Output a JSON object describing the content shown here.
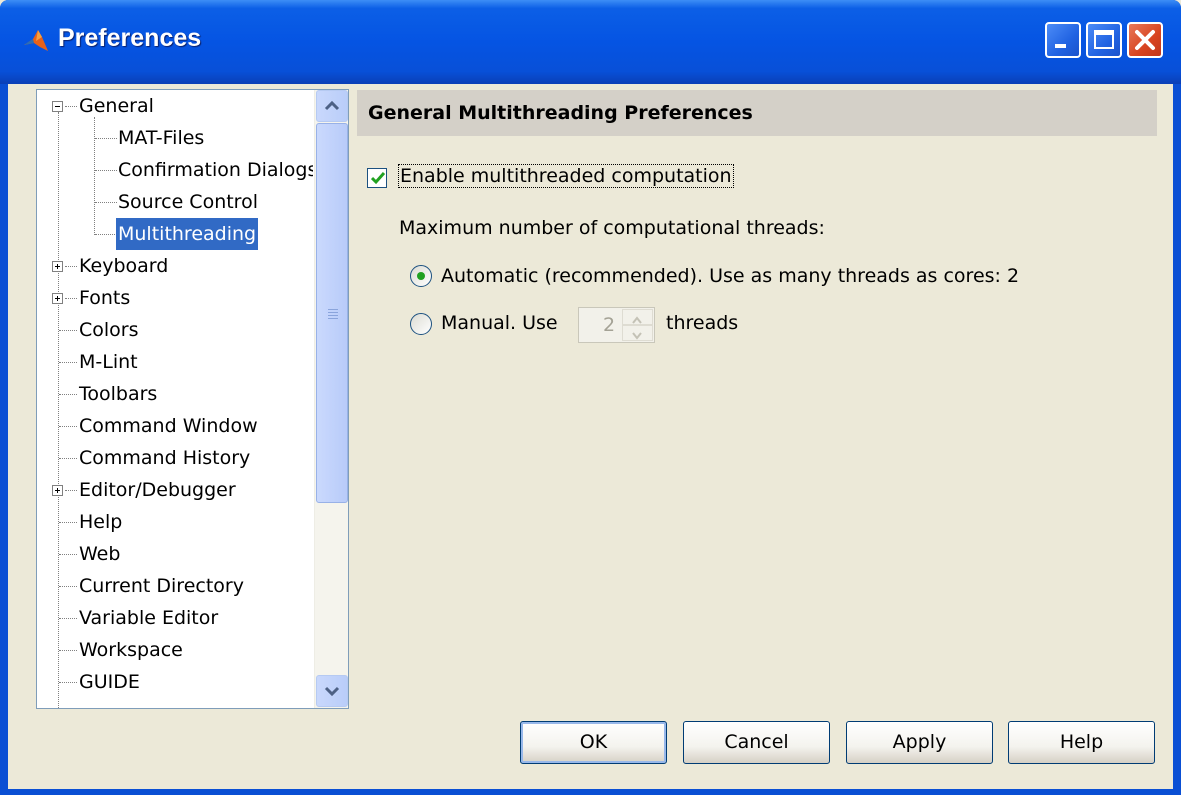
{
  "window": {
    "title": "Preferences",
    "title_icon": "matlab-logo-icon"
  },
  "tree": {
    "items": [
      {
        "label": "General",
        "expander": "minus"
      },
      {
        "label": "MAT-Files"
      },
      {
        "label": "Confirmation Dialogs"
      },
      {
        "label": "Source Control"
      },
      {
        "label": "Multithreading",
        "selected": true
      },
      {
        "label": "Keyboard",
        "expander": "plus"
      },
      {
        "label": "Fonts",
        "expander": "plus"
      },
      {
        "label": "Colors"
      },
      {
        "label": "M-Lint"
      },
      {
        "label": "Toolbars"
      },
      {
        "label": "Command Window"
      },
      {
        "label": "Command History"
      },
      {
        "label": "Editor/Debugger",
        "expander": "plus"
      },
      {
        "label": "Help"
      },
      {
        "label": "Web"
      },
      {
        "label": "Current Directory"
      },
      {
        "label": "Variable Editor"
      },
      {
        "label": "Workspace"
      },
      {
        "label": "GUIDE"
      }
    ]
  },
  "panel": {
    "header": "General Multithreading Preferences",
    "enable_label": "Enable multithreaded computation",
    "enable_checked": true,
    "max_threads_label": "Maximum number of computational threads:",
    "auto_label": "Automatic (recommended). Use as many threads as cores: 2",
    "manual_label": "Manual. Use",
    "manual_value": "2",
    "threads_label": "threads",
    "selected_mode": "automatic"
  },
  "buttons": {
    "ok": "OK",
    "cancel": "Cancel",
    "apply": "Apply",
    "help": "Help"
  },
  "colors": {
    "title_bar": "#0554e3",
    "selection": "#316ac5",
    "radio_dot": "#21a121",
    "check": "#21a121"
  }
}
